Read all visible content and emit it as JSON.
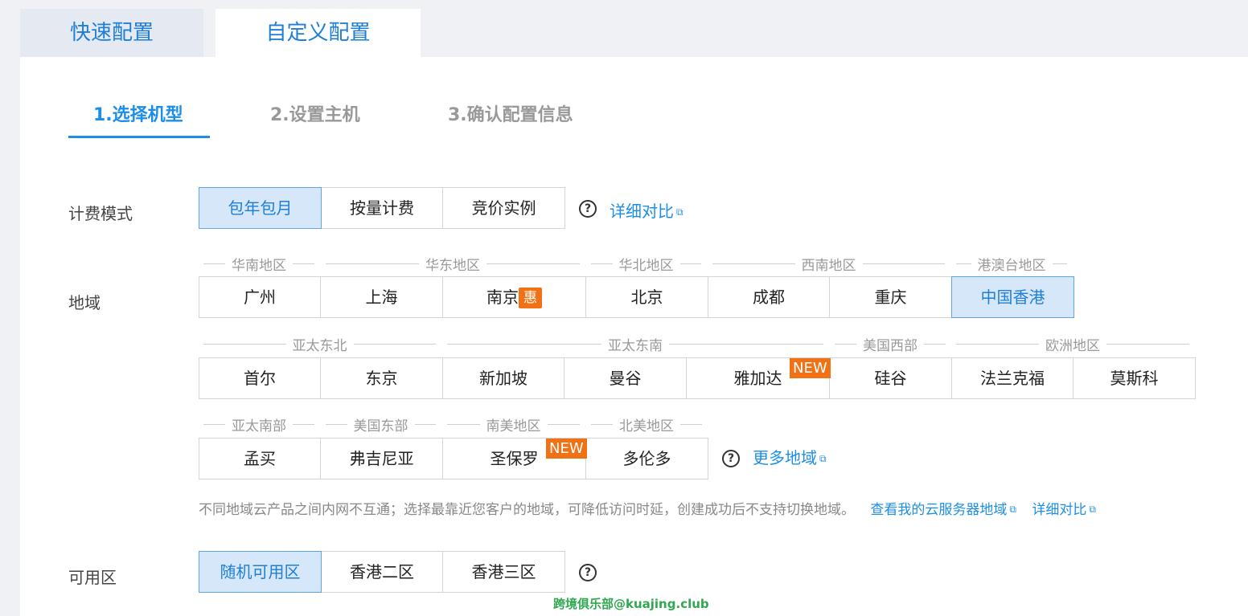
{
  "tabs": {
    "quick": "快速配置",
    "custom": "自定义配置"
  },
  "steps": [
    "1.选择机型",
    "2.设置主机",
    "3.确认配置信息"
  ],
  "billing": {
    "label": "计费模式",
    "options": [
      "包年包月",
      "按量计费",
      "竞价实例"
    ],
    "selected": "包年包月",
    "compare_link": "详细对比"
  },
  "region": {
    "label": "地域",
    "row1_groups": [
      "华南地区",
      "华东地区",
      "华北地区",
      "西南地区",
      "港澳台地区"
    ],
    "row1": [
      "广州",
      "上海",
      "南京",
      "北京",
      "成都",
      "重庆",
      "中国香港"
    ],
    "row2_groups": [
      "亚太东北",
      "亚太东南",
      "美国西部",
      "欧洲地区"
    ],
    "row2": [
      "首尔",
      "东京",
      "新加坡",
      "曼谷",
      "雅加达",
      "硅谷",
      "法兰克福",
      "莫斯科"
    ],
    "row3_groups": [
      "亚太南部",
      "美国东部",
      "南美地区",
      "北美地区"
    ],
    "row3": [
      "孟买",
      "弗吉尼亚",
      "圣保罗",
      "多伦多"
    ],
    "selected": "中国香港",
    "discount_badge": "惠",
    "new_badge": "NEW",
    "more_link": "更多地域",
    "note": "不同地域云产品之间内网不互通；选择最靠近您客户的地域，可降低访问时延，创建成功后不支持切换地域。",
    "my_regions_link": "查看我的云服务器地域",
    "compare_link": "详细对比"
  },
  "zone": {
    "label": "可用区",
    "options": [
      "随机可用区",
      "香港二区",
      "香港三区"
    ],
    "selected": "随机可用区"
  },
  "help_icon_text": "?",
  "external_icon_text": "⧉",
  "watermark": "跨境俱乐部@kuajing.club"
}
